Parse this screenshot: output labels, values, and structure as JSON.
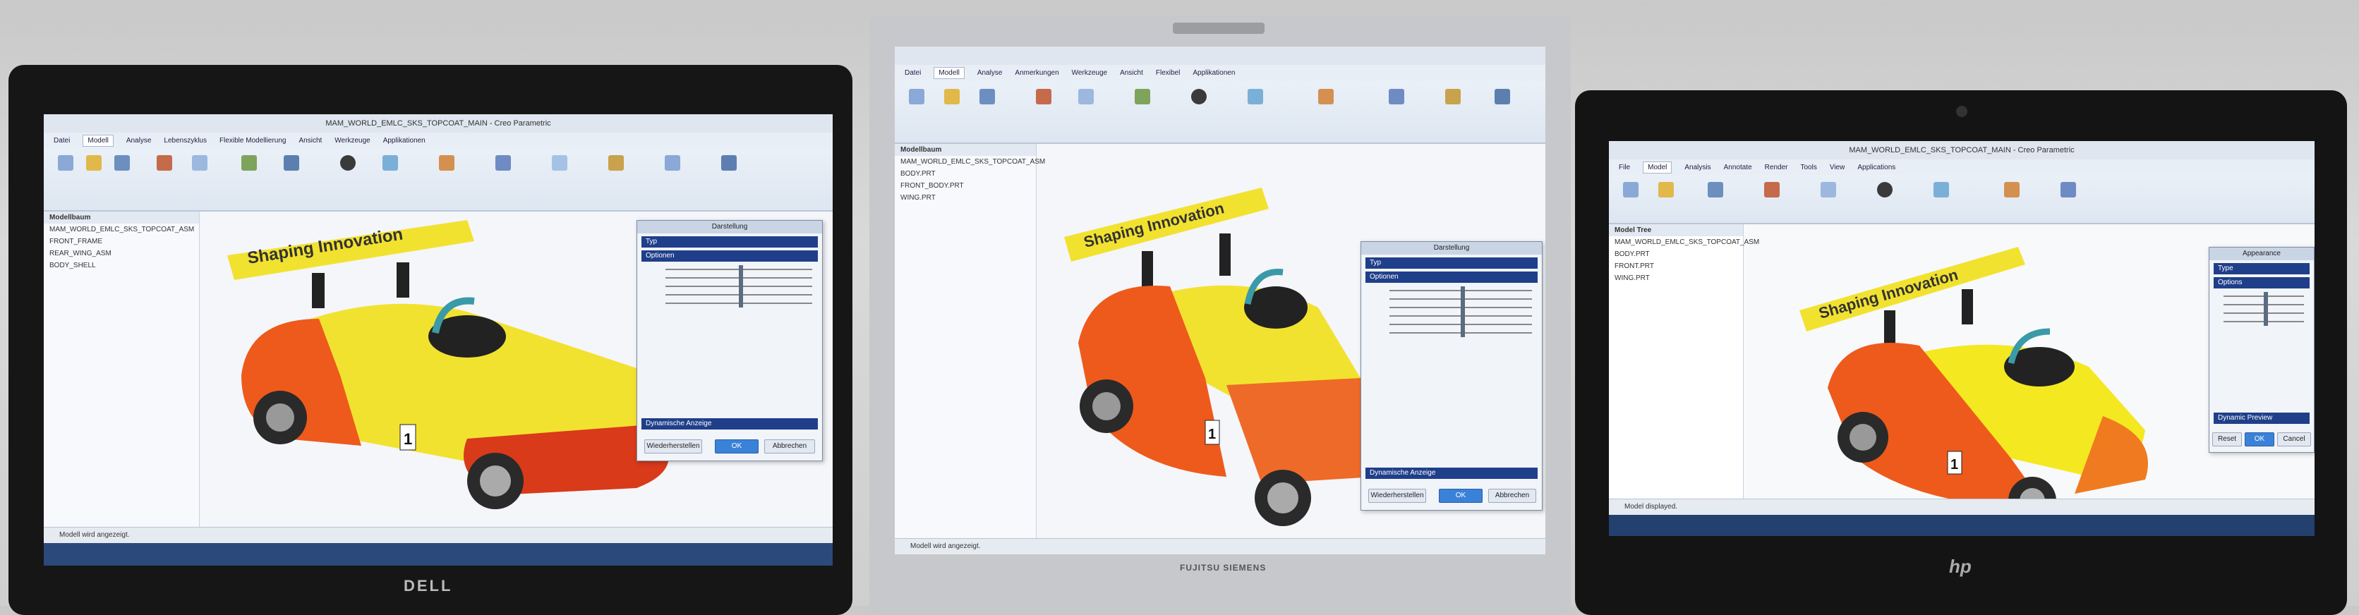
{
  "scene": {
    "description_free": true,
    "colors": {
      "background": "#d2d2d2",
      "bezel_dark": "#1a1a1a",
      "bezel_silver": "#c7c8cb",
      "car_yellow": "#f2e230",
      "car_orange": "#ee5a1c",
      "car_red": "#d93a1a",
      "ribbon_blue": "#1f3f8a"
    }
  },
  "laptops": [
    {
      "brand": "DELL",
      "titlebar": "MAM_WORLD_EMLC_SKS_TOPCOAT_MAIN - Creo Parametric",
      "tabs": [
        "Datei",
        "Modell",
        "Analyse",
        "Lebenszyklus",
        "Flexible Modellierung",
        "Ansicht",
        "Werkzeuge",
        "Applikationen"
      ],
      "tree_header": "Modellbaum",
      "tree_items": [
        "MAM_WORLD_EMLC_SKS_TOPCOAT_ASM",
        "FRONT_FRAME",
        "REAR_WING_ASM",
        "BODY_SHELL"
      ],
      "spoiler_text": "Shaping Innovation",
      "race_number": "1",
      "dialog": {
        "title": "Darstellung",
        "section1": "Typ",
        "section2": "Optionen",
        "button_default": "Wiederherstellen",
        "button_ok": "OK",
        "button_cancel": "Abbrechen",
        "footer": "Dynamische Anzeige"
      },
      "status": "Modell wird angezeigt."
    },
    {
      "brand": "FUJITSU SIEMENS",
      "titlebar": "",
      "tabs": [
        "Datei",
        "Modell",
        "Analyse",
        "Anmerkungen",
        "Werkzeuge",
        "Ansicht",
        "Flexibel",
        "Applikationen"
      ],
      "tree_header": "Modellbaum",
      "tree_items": [
        "MAM_WORLD_EMLC_SKS_TOPCOAT_ASM",
        "BODY.PRT",
        "FRONT_BODY.PRT",
        "WING.PRT"
      ],
      "spoiler_text": "Shaping Innovation",
      "race_number": "1",
      "dialog": {
        "title": "Darstellung",
        "section1": "Typ",
        "section2": "Optionen",
        "button_default": "Wiederherstellen",
        "button_ok": "OK",
        "button_cancel": "Abbrechen",
        "footer": "Dynamische Anzeige"
      },
      "status": "Modell wird angezeigt."
    },
    {
      "brand": "hp",
      "titlebar": "MAM_WORLD_EMLC_SKS_TOPCOAT_MAIN - Creo Parametric",
      "tabs": [
        "File",
        "Model",
        "Analysis",
        "Annotate",
        "Render",
        "Tools",
        "View",
        "Applications"
      ],
      "tree_header": "Model Tree",
      "tree_items": [
        "MAM_WORLD_EMLC_SKS_TOPCOAT_ASM",
        "BODY.PRT",
        "FRONT.PRT",
        "WING.PRT"
      ],
      "spoiler_text": "Shaping Innovation",
      "race_number": "1",
      "dialog": {
        "title": "Appearance",
        "section1": "Type",
        "section2": "Options",
        "button_default": "Reset",
        "button_ok": "OK",
        "button_cancel": "Cancel",
        "footer": "Dynamic Preview"
      },
      "status": "Model displayed."
    }
  ]
}
